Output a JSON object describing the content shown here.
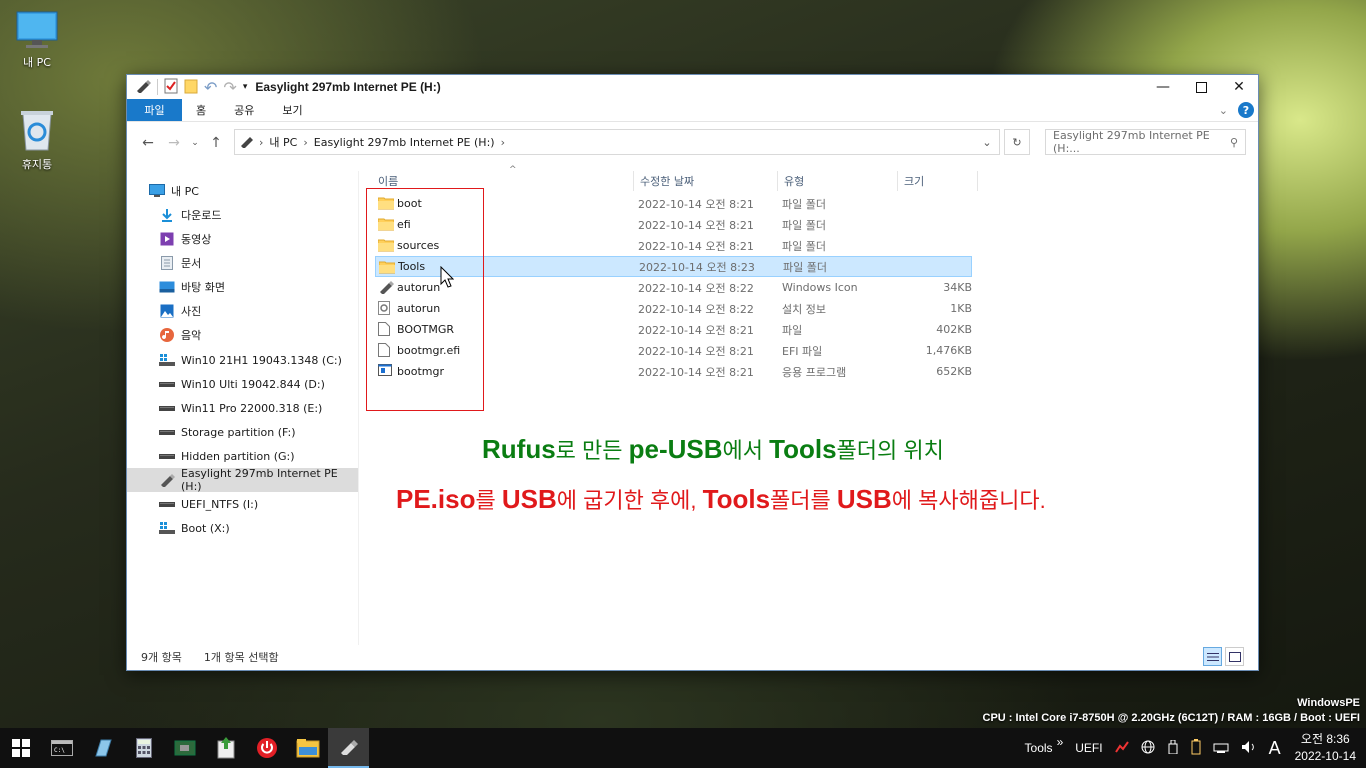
{
  "desktop": {
    "icons": [
      {
        "label": "내 PC",
        "icon": "monitor-icon"
      },
      {
        "label": "휴지통",
        "icon": "recycle-bin-icon"
      }
    ]
  },
  "window": {
    "title": "Easylight 297mb Internet PE (H:)",
    "ribbon_tabs": [
      "파일",
      "홈",
      "공유",
      "보기"
    ],
    "address": {
      "segments": [
        "내 PC",
        "Easylight 297mb Internet PE (H:)"
      ]
    },
    "search": {
      "placeholder": "Easylight 297mb Internet PE (H:..."
    },
    "nav": [
      {
        "label": "내 PC",
        "icon": "monitor-icon"
      },
      {
        "label": "다운로드",
        "icon": "download-icon"
      },
      {
        "label": "동영상",
        "icon": "video-icon"
      },
      {
        "label": "문서",
        "icon": "document-icon"
      },
      {
        "label": "바탕 화면",
        "icon": "desktop-icon"
      },
      {
        "label": "사진",
        "icon": "picture-icon"
      },
      {
        "label": "음악",
        "icon": "music-icon"
      },
      {
        "label": "Win10 21H1 19043.1348 (C:)",
        "icon": "windows-drive-icon"
      },
      {
        "label": "Win10 Ulti 19042.844 (D:)",
        "icon": "drive-icon"
      },
      {
        "label": "Win11 Pro 22000.318 (E:)",
        "icon": "drive-icon"
      },
      {
        "label": "Storage partition (F:)",
        "icon": "drive-icon"
      },
      {
        "label": "Hidden partition (G:)",
        "icon": "drive-icon"
      },
      {
        "label": "Easylight 297mb Internet PE (H:)",
        "icon": "usb-drive-icon"
      },
      {
        "label": "UEFI_NTFS (I:)",
        "icon": "drive-icon"
      },
      {
        "label": "Boot (X:)",
        "icon": "windows-drive-icon"
      }
    ],
    "columns": {
      "name": "이름",
      "date": "수정한 날짜",
      "type": "유형",
      "size": "크기"
    },
    "files": [
      {
        "name": "boot",
        "date": "2022-10-14 오전 8:21",
        "type": "파일 폴더",
        "size": "",
        "icon": "folder-icon"
      },
      {
        "name": "efi",
        "date": "2022-10-14 오전 8:21",
        "type": "파일 폴더",
        "size": "",
        "icon": "folder-icon"
      },
      {
        "name": "sources",
        "date": "2022-10-14 오전 8:21",
        "type": "파일 폴더",
        "size": "",
        "icon": "folder-icon"
      },
      {
        "name": "Tools",
        "date": "2022-10-14 오전 8:23",
        "type": "파일 폴더",
        "size": "",
        "icon": "folder-icon"
      },
      {
        "name": "autorun",
        "date": "2022-10-14 오전 8:22",
        "type": "Windows Icon",
        "size": "34KB",
        "icon": "usb-file-icon"
      },
      {
        "name": "autorun",
        "date": "2022-10-14 오전 8:22",
        "type": "설치 정보",
        "size": "1KB",
        "icon": "setup-info-icon"
      },
      {
        "name": "BOOTMGR",
        "date": "2022-10-14 오전 8:21",
        "type": "파일",
        "size": "402KB",
        "icon": "file-icon"
      },
      {
        "name": "bootmgr.efi",
        "date": "2022-10-14 오전 8:21",
        "type": "EFI 파일",
        "size": "1,476KB",
        "icon": "file-icon"
      },
      {
        "name": "bootmgr",
        "date": "2022-10-14 오전 8:21",
        "type": "응용 프로그램",
        "size": "652KB",
        "icon": "application-icon"
      }
    ],
    "annotation": {
      "line1": [
        "Rufus",
        "로 만든 ",
        "pe-USB",
        "에서 ",
        "Tools",
        "폴더의 위치"
      ],
      "line2": [
        "PE.iso",
        "를 ",
        "USB",
        "에 굽기한 후에, ",
        "Tools",
        "폴더를 ",
        "USB",
        "에 복사해줍니다."
      ],
      "color1": "#0a7d12",
      "color2": "#e0191b"
    },
    "status": {
      "count": "9개 항목",
      "selected": "1개 항목 선택함"
    }
  },
  "sysinfo": {
    "line1": "WindowsPE",
    "line2": "CPU : Intel Core i7-8750H @ 2.20GHz (6C12T) / RAM : 16GB / Boot : UEFI"
  },
  "taskbar": {
    "apps": [
      "start-icon",
      "terminal-icon",
      "notepad-icon",
      "calculator-icon",
      "hardware-icon",
      "installer-icon",
      "power-icon",
      "file-explorer-icon",
      "usb-drive-icon"
    ],
    "tray_tools": "Tools",
    "tray_chevron": "»",
    "tray_uefi": "UEFI",
    "ime": "A",
    "time": "오전 8:36",
    "date": "2022-10-14"
  },
  "colors": {
    "accent": "#1979ca",
    "selection": "#cce8ff"
  }
}
